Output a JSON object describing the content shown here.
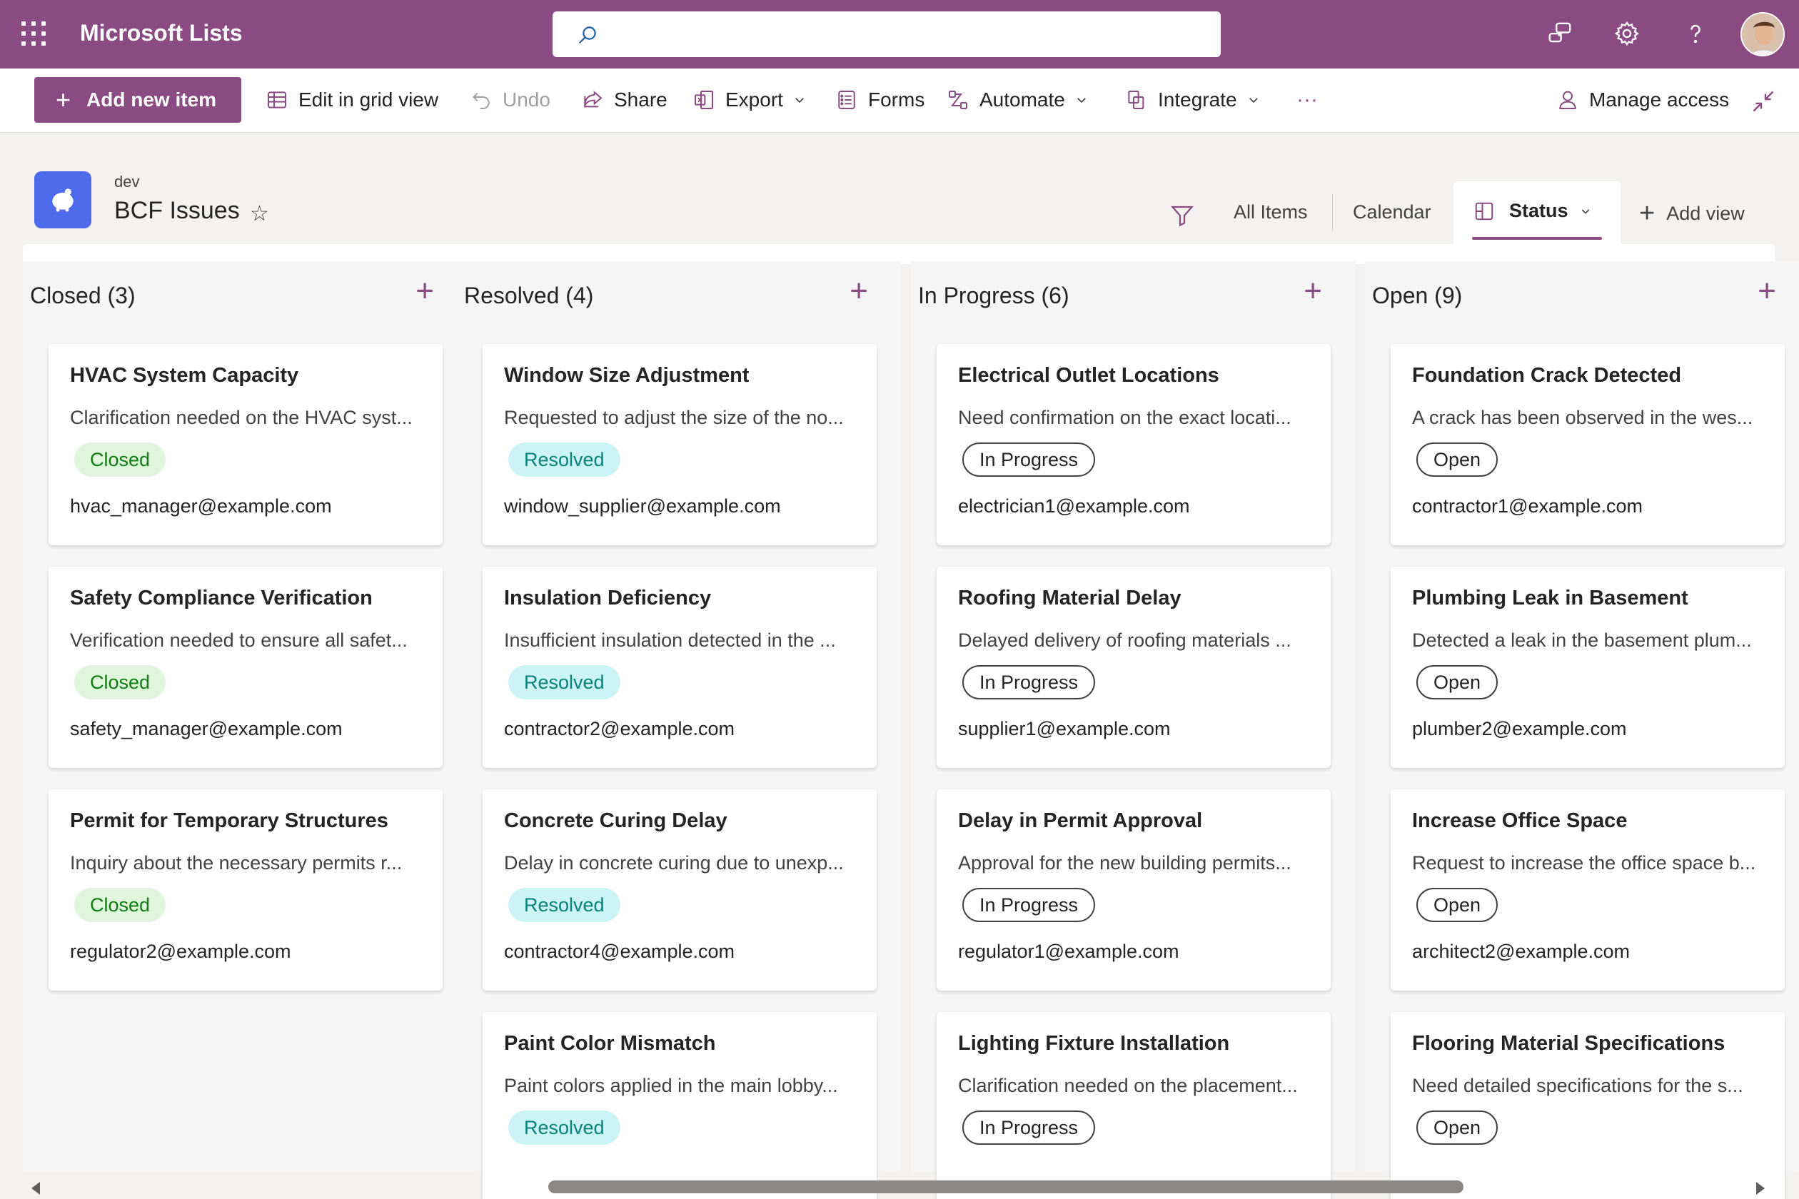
{
  "app": {
    "title": "Microsoft Lists"
  },
  "search": {
    "placeholder": ""
  },
  "toolbar": {
    "add_new_item": "Add new item",
    "edit_grid": "Edit in grid view",
    "undo": "Undo",
    "share": "Share",
    "export": "Export",
    "forms": "Forms",
    "automate": "Automate",
    "integrate": "Integrate",
    "more": "···",
    "manage_access": "Manage access"
  },
  "list": {
    "site": "dev",
    "title": "BCF Issues",
    "favorite_icon": "☆"
  },
  "views": {
    "all_items": "All Items",
    "calendar": "Calendar",
    "status": "Status",
    "add_view": "Add view"
  },
  "colors": {
    "brand": "#8a4a82",
    "closed_bg": "#dff6dd",
    "resolved_bg": "#ccf3f5"
  },
  "board": {
    "columns": [
      {
        "header": "Closed (3)",
        "add": "+",
        "cards": [
          {
            "title": "HVAC System Capacity",
            "desc": "Clarification needed on the HVAC syst...",
            "status": "Closed",
            "email": "hvac_manager@example.com"
          },
          {
            "title": "Safety Compliance Verification",
            "desc": "Verification needed to ensure all safet...",
            "status": "Closed",
            "email": "safety_manager@example.com"
          },
          {
            "title": "Permit for Temporary Structures",
            "desc": "Inquiry about the necessary permits r...",
            "status": "Closed",
            "email": "regulator2@example.com"
          }
        ]
      },
      {
        "header": "Resolved (4)",
        "add": "+",
        "cards": [
          {
            "title": "Window Size Adjustment",
            "desc": "Requested to adjust the size of the no...",
            "status": "Resolved",
            "email": "window_supplier@example.com"
          },
          {
            "title": "Insulation Deficiency",
            "desc": "Insufficient insulation detected in the ...",
            "status": "Resolved",
            "email": "contractor2@example.com"
          },
          {
            "title": "Concrete Curing Delay",
            "desc": "Delay in concrete curing due to unexp...",
            "status": "Resolved",
            "email": "contractor4@example.com"
          },
          {
            "title": "Paint Color Mismatch",
            "desc": "Paint colors applied in the main lobby...",
            "status": "Resolved",
            "email": ""
          }
        ]
      },
      {
        "header": "In Progress (6)",
        "add": "+",
        "cards": [
          {
            "title": "Electrical Outlet Locations",
            "desc": "Need confirmation on the exact locati...",
            "status": "In Progress",
            "email": "electrician1@example.com"
          },
          {
            "title": "Roofing Material Delay",
            "desc": "Delayed delivery of roofing materials ...",
            "status": "In Progress",
            "email": "supplier1@example.com"
          },
          {
            "title": "Delay in Permit Approval",
            "desc": "Approval for the new building permits...",
            "status": "In Progress",
            "email": "regulator1@example.com"
          },
          {
            "title": "Lighting Fixture Installation",
            "desc": "Clarification needed on the placement...",
            "status": "In Progress",
            "email": ""
          }
        ]
      },
      {
        "header": "Open (9)",
        "add": "+",
        "cards": [
          {
            "title": "Foundation Crack Detected",
            "desc": "A crack has been observed in the wes...",
            "status": "Open",
            "email": "contractor1@example.com"
          },
          {
            "title": "Plumbing Leak in Basement",
            "desc": "Detected a leak in the basement plum...",
            "status": "Open",
            "email": "plumber2@example.com"
          },
          {
            "title": "Increase Office Space",
            "desc": "Request to increase the office space b...",
            "status": "Open",
            "email": "architect2@example.com"
          },
          {
            "title": "Flooring Material Specifications",
            "desc": "Need detailed specifications for the s...",
            "status": "Open",
            "email": ""
          }
        ]
      }
    ]
  }
}
